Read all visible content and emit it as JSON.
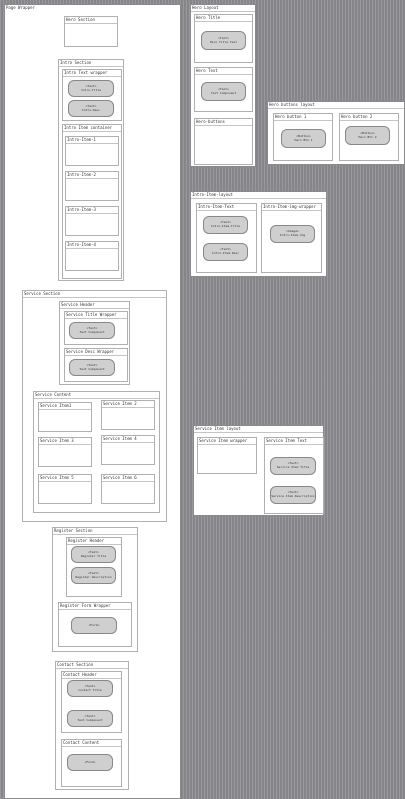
{
  "page_wrapper": {
    "label": "Page Wrapper"
  },
  "hero_section": {
    "label": "Hero Section"
  },
  "intro_section": {
    "label": "Intro Section",
    "text_wrapper": {
      "label": "Intro Text wrapper",
      "pill1": [
        "<Text>",
        "Intro-Title"
      ],
      "pill2": [
        "<Text>",
        "Intro-Desc"
      ]
    },
    "item_container": {
      "label": "Intro Item container",
      "items": [
        "Intro-Item-1",
        "Intro-Item-2",
        "Intro-Item-3",
        "Intro-Item-4"
      ]
    }
  },
  "service_section": {
    "label": "Service Section",
    "header": {
      "label": "Service Header",
      "title_wrapper": {
        "label": "Service Title Wrapper",
        "pill": [
          "<Text>",
          "Text Component"
        ]
      },
      "desc_wrapper": {
        "label": "Service Desc Wrapper",
        "pill": [
          "<Text>",
          "Text Component"
        ]
      }
    },
    "content": {
      "label": "Service Content",
      "items": [
        "Service Item1",
        "Service Item 2",
        "Service Item 3",
        "Service Item 4",
        "Service Item 5",
        "Service Item 6"
      ]
    }
  },
  "register_section": {
    "label": "Register Section",
    "header": {
      "label": "Register Header",
      "pill1": [
        "<Text>",
        "Register Title"
      ],
      "pill2": [
        "<Text>",
        "Register Description"
      ]
    },
    "form_wrapper": {
      "label": "Register Form Wrapper",
      "pill": [
        "<Form>"
      ]
    }
  },
  "contact_section": {
    "label": "Contact Section",
    "header": {
      "label": "Contact Header",
      "pill1": [
        "<Text>",
        "Contact Title"
      ],
      "pill2": [
        "<Text>",
        "Text Component"
      ]
    },
    "content": {
      "label": "Contact Content",
      "pill": [
        "<Form>"
      ]
    }
  },
  "hero_layout": {
    "label": "Hero Layout",
    "title": {
      "label": "Hero Title",
      "pill": [
        "<Text>",
        "Hero Title Text"
      ]
    },
    "text": {
      "label": "Hero Text",
      "pill": [
        "<Text>",
        "Text Component"
      ]
    },
    "buttons": {
      "label": "Hero-buttons"
    }
  },
  "hero_buttons_layout": {
    "label": "Hero buttons layout",
    "button1": {
      "label": "Hero button 1",
      "pill": [
        "<Button>",
        "Hero Btn 1"
      ]
    },
    "button2": {
      "label": "Hero button 2",
      "pill": [
        "<Button>",
        "Hero Btn 2"
      ]
    }
  },
  "intro_item_layout": {
    "label": "Intro-Item-layout",
    "text": {
      "label": "Intro-Item-Text",
      "pill1": [
        "<Text>",
        "Intro-Item-Title"
      ],
      "pill2": [
        "<Text>",
        "Intro-Item-Desc"
      ]
    },
    "img_wrapper": {
      "label": "Intro-Item-img-wrapper",
      "pill": [
        "<Image>",
        "Intro-Item-img"
      ]
    }
  },
  "service_item_layout": {
    "label": "Service Item layout",
    "img_wrapper": {
      "label": "Service Item wrapper"
    },
    "text": {
      "label": "Service Item Text",
      "pill1": [
        "<Text>",
        "Service Item Title"
      ],
      "pill2": [
        "<Text>",
        "Service Item Description"
      ]
    }
  }
}
